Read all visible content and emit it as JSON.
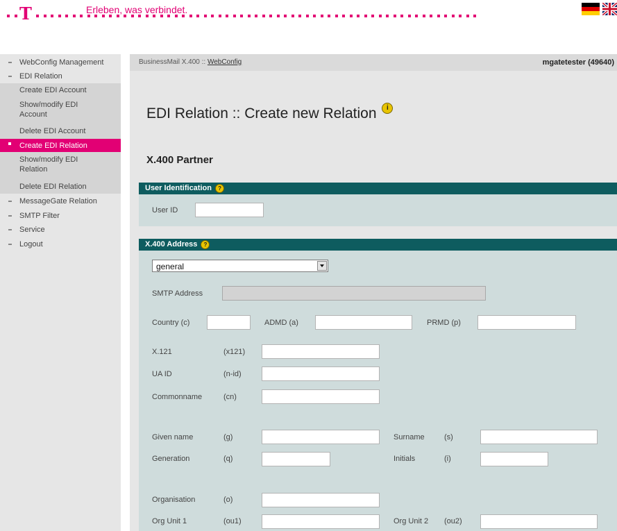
{
  "header": {
    "logo": "T",
    "slogan": "Erleben, was verbindet.",
    "flags": [
      "german-flag-icon",
      "uk-flag-icon"
    ]
  },
  "sidebar": {
    "items": [
      {
        "label": "WebConfig Management",
        "level": "top"
      },
      {
        "label": "EDI Relation",
        "level": "top"
      },
      {
        "label": "Create EDI Account",
        "level": "sub"
      },
      {
        "label": "Show/modify EDI Account",
        "level": "sub"
      },
      {
        "label": "Delete EDI Account",
        "level": "sub"
      },
      {
        "label": "Create EDI Relation",
        "level": "active"
      },
      {
        "label": "Show/modify EDI Relation",
        "level": "sub"
      },
      {
        "label": "Delete EDI Relation",
        "level": "sub"
      },
      {
        "label": "MessageGate Relation",
        "level": "top"
      },
      {
        "label": "SMTP Filter",
        "level": "top"
      },
      {
        "label": "Service",
        "level": "top"
      },
      {
        "label": "Logout",
        "level": "top"
      }
    ]
  },
  "breadcrumb": {
    "prefix": "BusinessMail X.400 :: ",
    "link": "WebConfig"
  },
  "user": "mgatetester (49640)",
  "page_title": "EDI Relation :: Create new Relation",
  "subtitle": "X.400 Partner",
  "user_identification": {
    "heading": "User Identification",
    "user_id_label": "User ID",
    "user_id_value": ""
  },
  "x400_address": {
    "heading": "X.400 Address",
    "select_value": "general",
    "smtp_label": "SMTP Address",
    "country_label": "Country (c)",
    "admd_label": "ADMD (a)",
    "prmd_label": "PRMD (p)",
    "x121_label": "X.121",
    "x121_code": "(x121)",
    "uaid_label": "UA ID",
    "uaid_code": "(n-id)",
    "cn_label": "Commonname",
    "cn_code": "(cn)",
    "given_label": "Given name",
    "given_code": "(g)",
    "surname_label": "Surname",
    "surname_code": "(s)",
    "generation_label": "Generation",
    "generation_code": "(q)",
    "initials_label": "Initials",
    "initials_code": "(i)",
    "org_label": "Organisation",
    "org_code": "(o)",
    "ou1_label": "Org Unit 1",
    "ou1_code": "(ou1)",
    "ou2_label": "Org Unit 2",
    "ou2_code": "(ou2)"
  }
}
